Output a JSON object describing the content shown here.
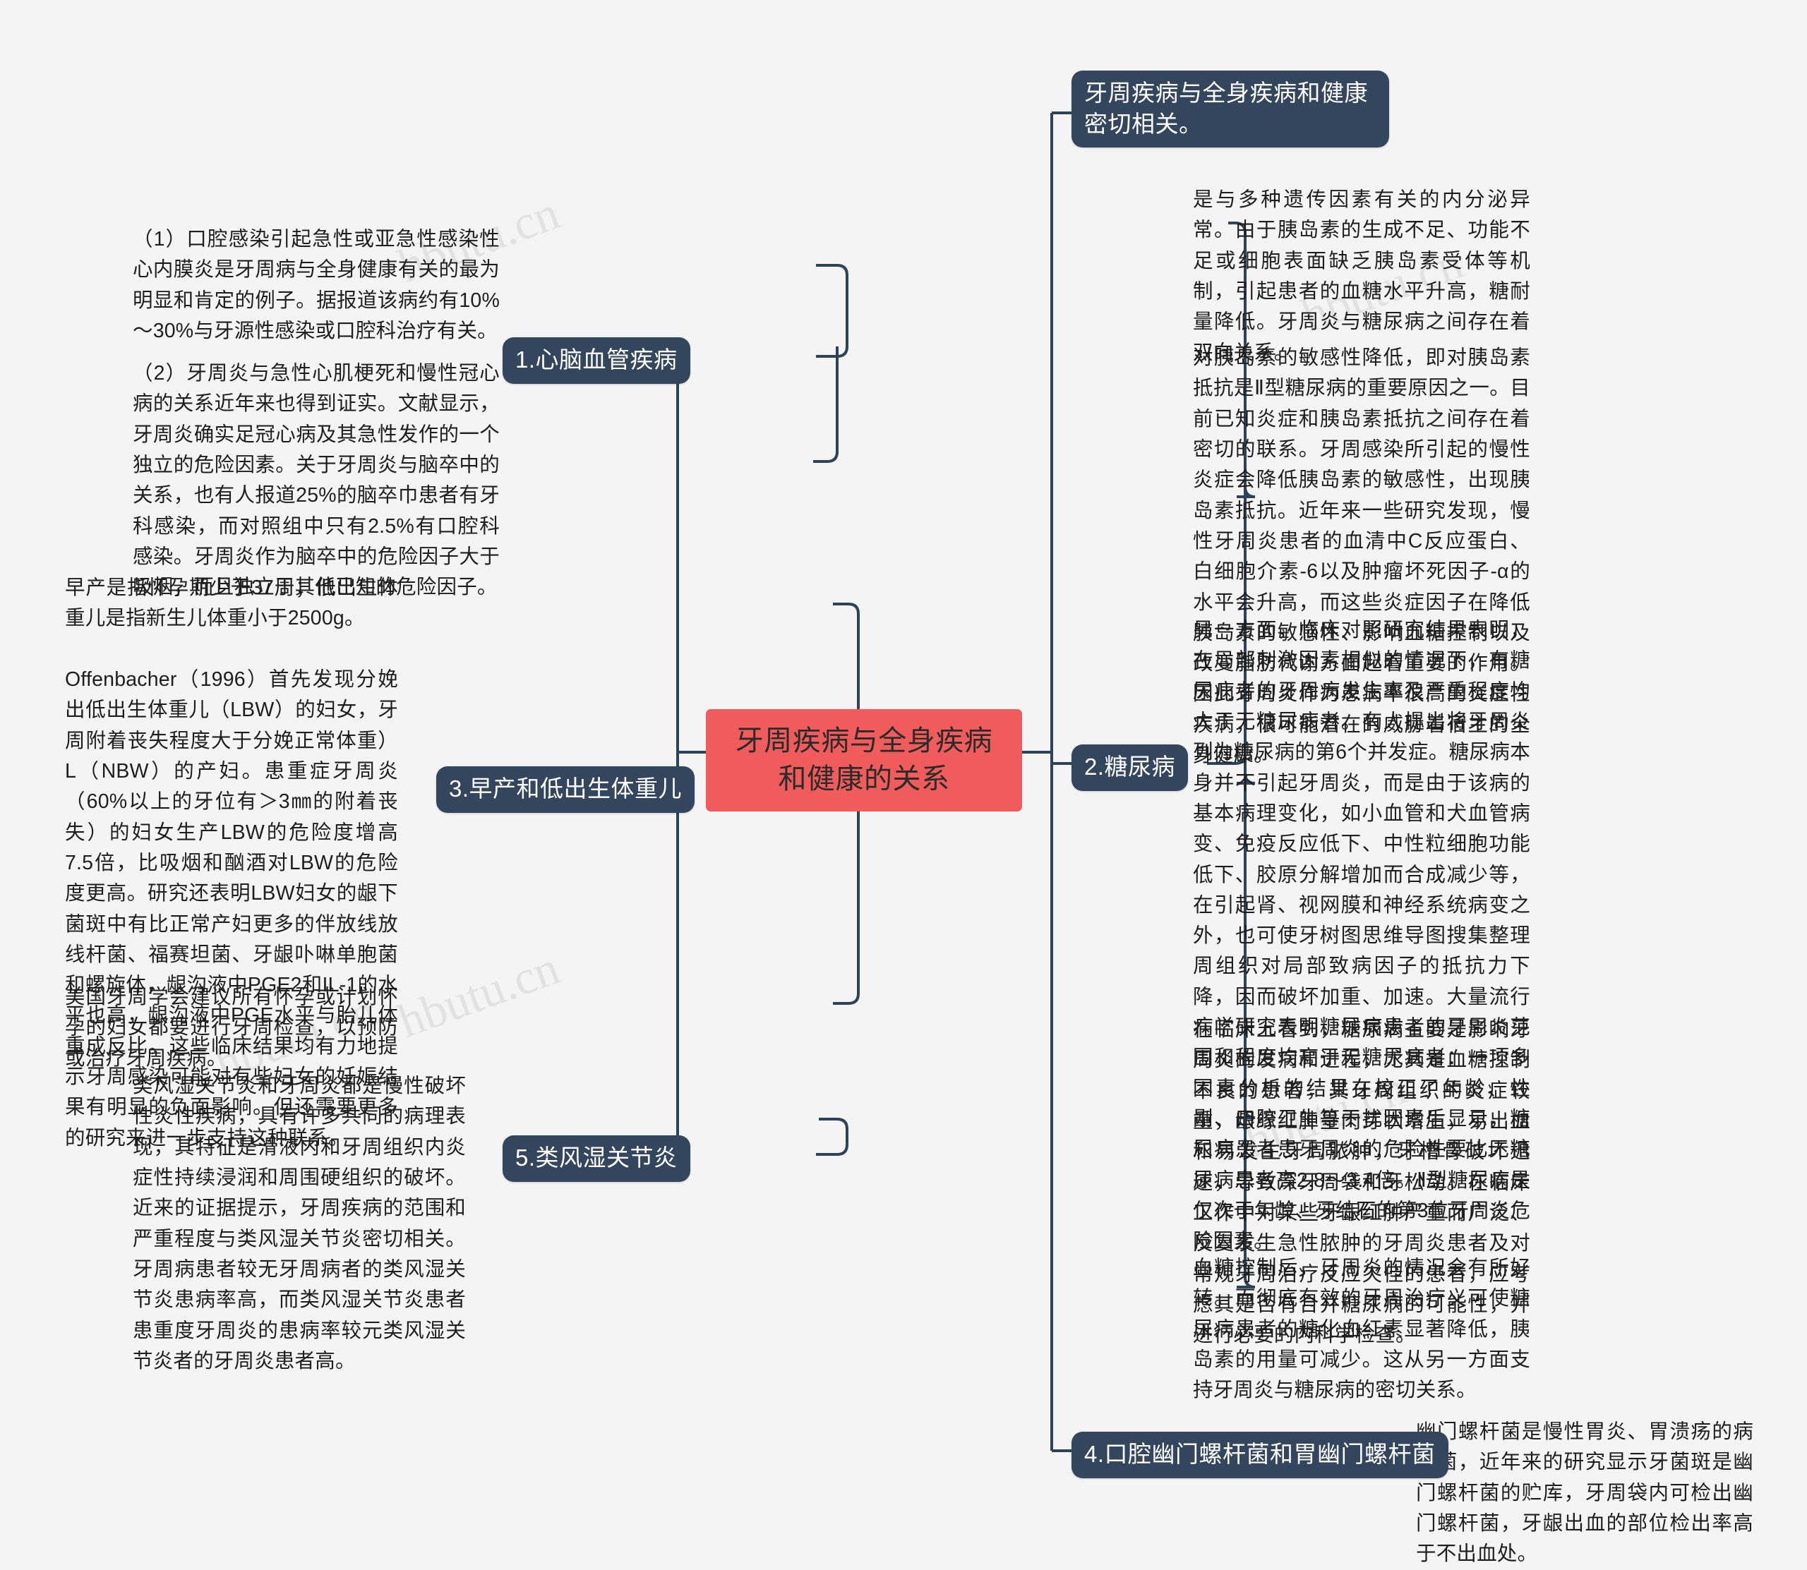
{
  "meta": {
    "background_color": "#f4f4f4",
    "node_color": "#33465e",
    "root_color": "#f05b5b",
    "link_color": "#2e4258",
    "text_color": "#1e1e1e",
    "watermark_text": "hbutu.cn"
  },
  "root": {
    "label": "牙周疾病与全身疾病和健康的关系"
  },
  "top_note": {
    "label": "牙周疾病与全身疾病和健康密切相关。"
  },
  "branches": [
    {
      "id": "cardio",
      "label": "1.心脑血管疾病",
      "leaves": [
        "（1）口腔感染引起急性或亚急性感染性心内膜炎是牙周病与全身健康有关的最为明显和肯定的例子。据报道该病约有10%～30%与牙源性感染或口腔科治疗有关。",
        "（2）牙周炎与急性心肌梗死和慢性冠心病的关系近年来也得到证实。文献显示，牙周炎确实足冠心病及其急性发作的一个独立的危险因素。关于牙周炎与脑卒中的关系，也有人报道25%的脑卒巾患者有牙科感染，而对照组中只有2.5%有口腔科感染。牙周炎作为脑卒中的危险因子大于吸烟，而且独立于其他已知的危险因子。"
      ]
    },
    {
      "id": "diabetes",
      "label": "2.糖尿病",
      "leaves": [
        "是与多种遗传因素有关的内分泌异常。由于胰岛素的生成不足、功能不足或细胞表面缺乏胰岛素受体等机制，引起患者的血糖水平升高，糖耐量降低。牙周炎与糖尿病之间存在着双向关系。",
        "对胰岛素的敏感性降低，即对胰岛素抵抗是Ⅱ型糖尿病的重要原因之一。目前已知炎症和胰岛素抵抗之间存在着密切的联系。牙周感染所引起的慢性炎症会降低胰岛素的敏感性，出现胰岛素抵抗。近年来一些研究发现，慢性牙周炎患者的血清中C反应蛋白、白细胞介素-6以及肿瘤坏死因子-α的水平会升高，而这些炎症因子在降低胰岛素的敏感性、影响血糖控制以及改变脂肪代谢方面起着重要的作用。因此牙周炎作为患病率很高的炎症性疾病，很可能潜在的威胁着宿主的全身健康。",
        "另一方面，临床对照研究结果表明，在局部刺激因素相似的情况下，有糖尿病者的牙周病发生率及严重程度均大于无糖尿病者。有人提出将牙周炎列为糖尿病的第6个并发症。糖尿病本身并不引起牙周炎，而是由于该病的基本病理变化，如小血管和犬血管病变、免疫反应低下、中性粒细胞功能低下、胶原分解增加而合成减少等，在引起肾、视网膜和神经系统病变之外，也可使牙树图思维导图搜集整理周组织对局部致病因子的抵抗力下降，因而破坏加重、加速。大量流行病学研究表明糖尿病患者的牙周炎范围和程度均高于无糖尿病者：一项多因素分析的结果在校正了年龄、性剐、口腔卫生等干扰因素后显示，糖尿病患者患牙周炎的危险性要比无糖尿病患者高2.8～3.4倍。Ⅱ型糖尿病是仅次于年龄、牙结石的第3位牙周炎危险因素。",
        "在临床上看到，糖尿病主要是影响牙周炎的发病和进程，尤其是血糖控制不良的患者，其牙周组织的炎症较重，龈缘红肿呈肉芽状增生，易出血和易发生牙周脓肿，牙槽骨破坏迅速，导致深牙周袋和牙松动。在临床工作中对某些牙龈红肿严重而广泛、反复发生急性脓肿的牙周炎患者及对常规牙周治疗反应欠佳的患者，应考虑其是否有合并糖尿病的可能性，并进行必要的内科学检查。",
        "血糖控制后，牙周炎的情况会有所好转。而彻底有效的牙周治疗义可使糖尿病患者的糖化血红素显著降低，胰岛素的用量可减少。这从另一方面支持牙周炎与糖尿病的密切关系。"
      ]
    },
    {
      "id": "preterm",
      "label": "3.早产和低出生体重儿",
      "leaves": [
        "早产是指怀孕期少于37周；低出生体重儿是指新生儿体重小于2500g。",
        "Offenbacher（1996）首先发现分娩出低出生体重儿（LBW）的妇女，牙周附着丧失程度大于分娩正常体重）L（NBW）的产妇。患重症牙周炎（60%以上的牙位有＞3㎜的附着丧失）的妇女生产LBW的危险度增高7.5倍，比吸烟和酗酒对LBW的危险度更高。研究还表明LBW妇女的龈下菌斑中有比正常产妇更多的伴放线放线杆菌、福赛坦菌、牙龈卟啉单胞菌和螺旋体，龈沟液中PGE2和IL-1的水平也高，龈沟液中PGE水平与胎儿体重成反比。这些临床结果均有力地提示牙周感染可能对有些妇女的妊娠结果有明显的负面影响。但还需要更多的研究来进一步支持这种联系。",
        "美国牙周学会建议所有怀孕或计划怀孕的妇女都要进行牙周检查，以预防或治疗牙周疾病。"
      ]
    },
    {
      "id": "hpylori",
      "label": "4.口腔幽门螺杆菌和胃幽门螺杆菌",
      "leaves": [
        "幽门螺杆菌是慢性胃炎、胃溃疡的病原菌，近年来的研究显示牙菌斑是幽门螺杆菌的贮库，牙周袋内可检出幽门螺杆菌，牙龈出血的部位检出率高于不出血处。"
      ]
    },
    {
      "id": "ra",
      "label": "5.类风湿关节炎",
      "leaves": [
        "类风湿关节炎和牙周炎都是慢性破坏性炎性疾病，具有许多共同的病理表现，其特征是滑液内和牙周组织内炎症性持续浸润和周围硬组织的破坏。近来的证据提示，牙周疾病的范围和严重程度与类风湿关节炎密切相关。牙周病患者较无牙周病者的类风湿关节炎患病率高，而类风湿关节炎患者患重度牙周炎的患病率较元类风湿关节炎者的牙周炎患者高。"
      ]
    }
  ]
}
